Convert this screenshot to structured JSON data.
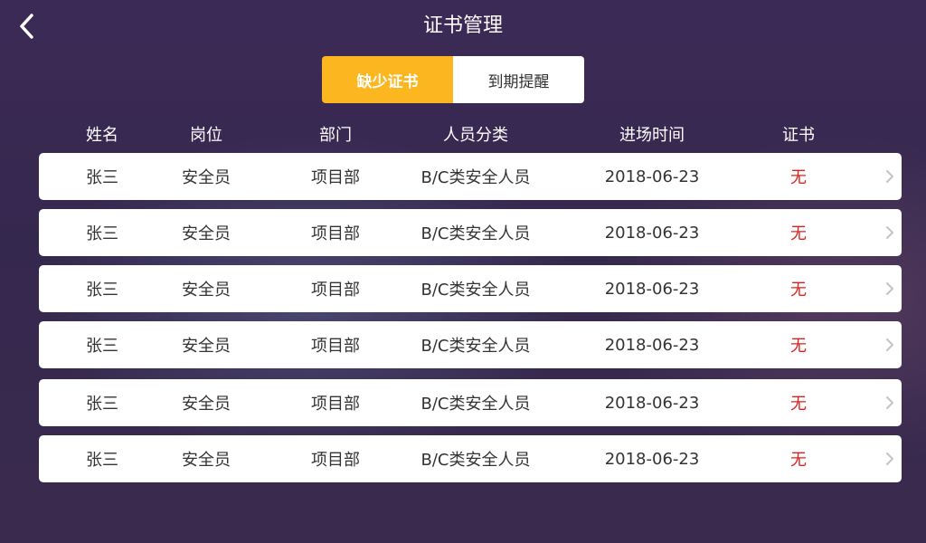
{
  "header": {
    "title": "证书管理",
    "back_icon": "chevron-left-icon"
  },
  "tabs": [
    {
      "label": "缺少证书",
      "active": true
    },
    {
      "label": "到期提醒",
      "active": false
    }
  ],
  "colors": {
    "accent": "#fbb620",
    "status_missing": "#e02020"
  },
  "table": {
    "columns": [
      "姓名",
      "岗位",
      "部门",
      "人员分类",
      "进场时间",
      "证书"
    ],
    "rows": [
      {
        "name": "张三",
        "position": "安全员",
        "department": "项目部",
        "category": "B/C类安全人员",
        "entry_date": "2018-06-23",
        "certificate": "无"
      },
      {
        "name": "张三",
        "position": "安全员",
        "department": "项目部",
        "category": "B/C类安全人员",
        "entry_date": "2018-06-23",
        "certificate": "无"
      },
      {
        "name": "张三",
        "position": "安全员",
        "department": "项目部",
        "category": "B/C类安全人员",
        "entry_date": "2018-06-23",
        "certificate": "无"
      },
      {
        "name": "张三",
        "position": "安全员",
        "department": "项目部",
        "category": "B/C类安全人员",
        "entry_date": "2018-06-23",
        "certificate": "无"
      },
      {
        "name": "张三",
        "position": "安全员",
        "department": "项目部",
        "category": "B/C类安全人员",
        "entry_date": "2018-06-23",
        "certificate": "无"
      },
      {
        "name": "张三",
        "position": "安全员",
        "department": "项目部",
        "category": "B/C类安全人员",
        "entry_date": "2018-06-23",
        "certificate": "无"
      }
    ],
    "row_icon": "chevron-right-icon"
  }
}
